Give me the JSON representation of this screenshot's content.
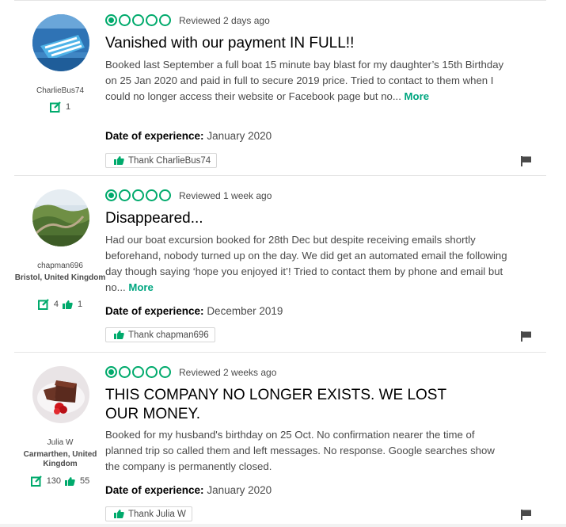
{
  "colors": {
    "accent": "#00aa6c",
    "more": "#00a680"
  },
  "reviews": [
    {
      "username": "CharlieBus74",
      "location": "",
      "reviews_count": "1",
      "helpful_votes": "",
      "rating": 1,
      "reviewed": "Reviewed 2 days ago",
      "title": "Vanished with our payment IN FULL!!",
      "body": "Booked last September a full boat 15 minute bay blast for my daughter’s 15th Birthday on 25 Jan 2020 and paid in full to secure 2019 price. Tried to contact to them when I could no longer access their website or Facebook page but no...",
      "more": "More",
      "experience_label": "Date of experience:",
      "experience_value": "January 2020",
      "thank_label": "Thank CharlieBus74"
    },
    {
      "username": "chapman696",
      "location": "Bristol, United Kingdom",
      "reviews_count": "4",
      "helpful_votes": "1",
      "rating": 1,
      "reviewed": "Reviewed 1 week ago",
      "title": "Disappeared...",
      "body": "Had our boat excursion booked for 28th Dec but despite receiving emails shortly beforehand, nobody turned up on the day. We did get an automated email the following day though saying ‘hope you enjoyed it’! Tried to contact them by phone and email but no...",
      "more": "More",
      "experience_label": "Date of experience:",
      "experience_value": "December 2019",
      "thank_label": "Thank chapman696"
    },
    {
      "username": "Julia W",
      "location": "Carmarthen, United Kingdom",
      "reviews_count": "130",
      "helpful_votes": "55",
      "rating": 1,
      "reviewed": "Reviewed 2 weeks ago",
      "title": "THIS COMPANY NO LONGER EXISTS. WE LOST OUR MONEY.",
      "body": "Booked for my husband's birthday on 25 Oct. No confirmation nearer the time of planned trip so called them and left messages. No response. Google searches show the company is permanently closed.",
      "more": "",
      "experience_label": "Date of experience:",
      "experience_value": "January 2020",
      "thank_label": "Thank Julia W"
    }
  ]
}
